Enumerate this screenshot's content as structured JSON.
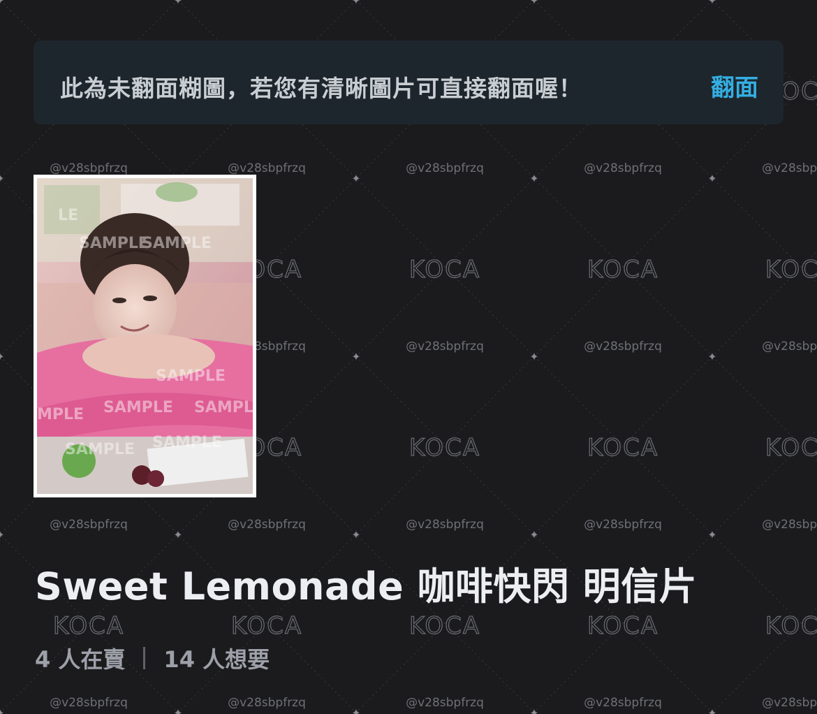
{
  "notice": {
    "message": "此為未翻面糊圖，若您有清晰圖片可直接翻面喔！",
    "flip_label": "翻面"
  },
  "card": {
    "image_icon": "photocard-image",
    "overlay_text": "SAMPLE"
  },
  "item": {
    "title": "Sweet Lemonade 咖啡快閃 明信片",
    "selling": "4 人在賣",
    "wanting": "14 人想要"
  },
  "watermark": {
    "logo": "KOCA",
    "user_tag": "@v28sbpfrzq"
  },
  "colors": {
    "background": "#1b1b1d",
    "notice_bg": "#1d262c",
    "accent": "#34aee2",
    "title": "#eceef2",
    "muted": "#9da0a8"
  }
}
